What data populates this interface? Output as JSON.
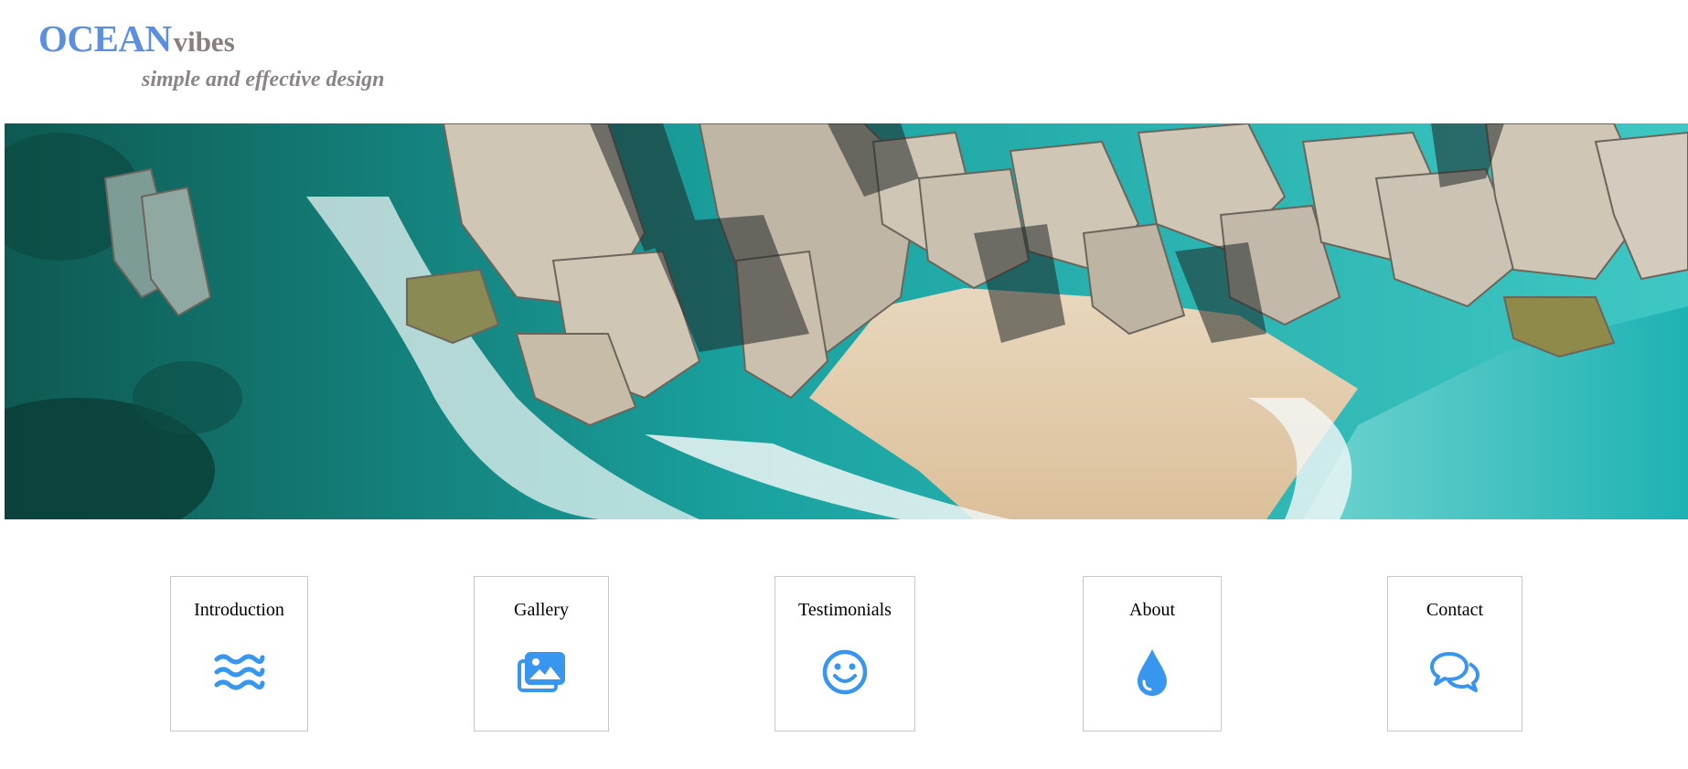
{
  "brand": {
    "primary": "OCEAN",
    "secondary": "vibes",
    "primary_color": "#5b8fe0",
    "secondary_color": "#8a7f7f",
    "tagline": "simple and effective design",
    "tagline_color": "#8c8585"
  },
  "hero": {
    "icon": "aerial-beach-photo"
  },
  "nav": {
    "icon_color": "#3896ef",
    "items": [
      {
        "label": "Introduction",
        "icon": "waves-icon"
      },
      {
        "label": "Gallery",
        "icon": "images-icon"
      },
      {
        "label": "Testimonials",
        "icon": "smile-icon"
      },
      {
        "label": "About",
        "icon": "water-drop-icon"
      },
      {
        "label": "Contact",
        "icon": "chat-bubbles-icon"
      }
    ]
  }
}
